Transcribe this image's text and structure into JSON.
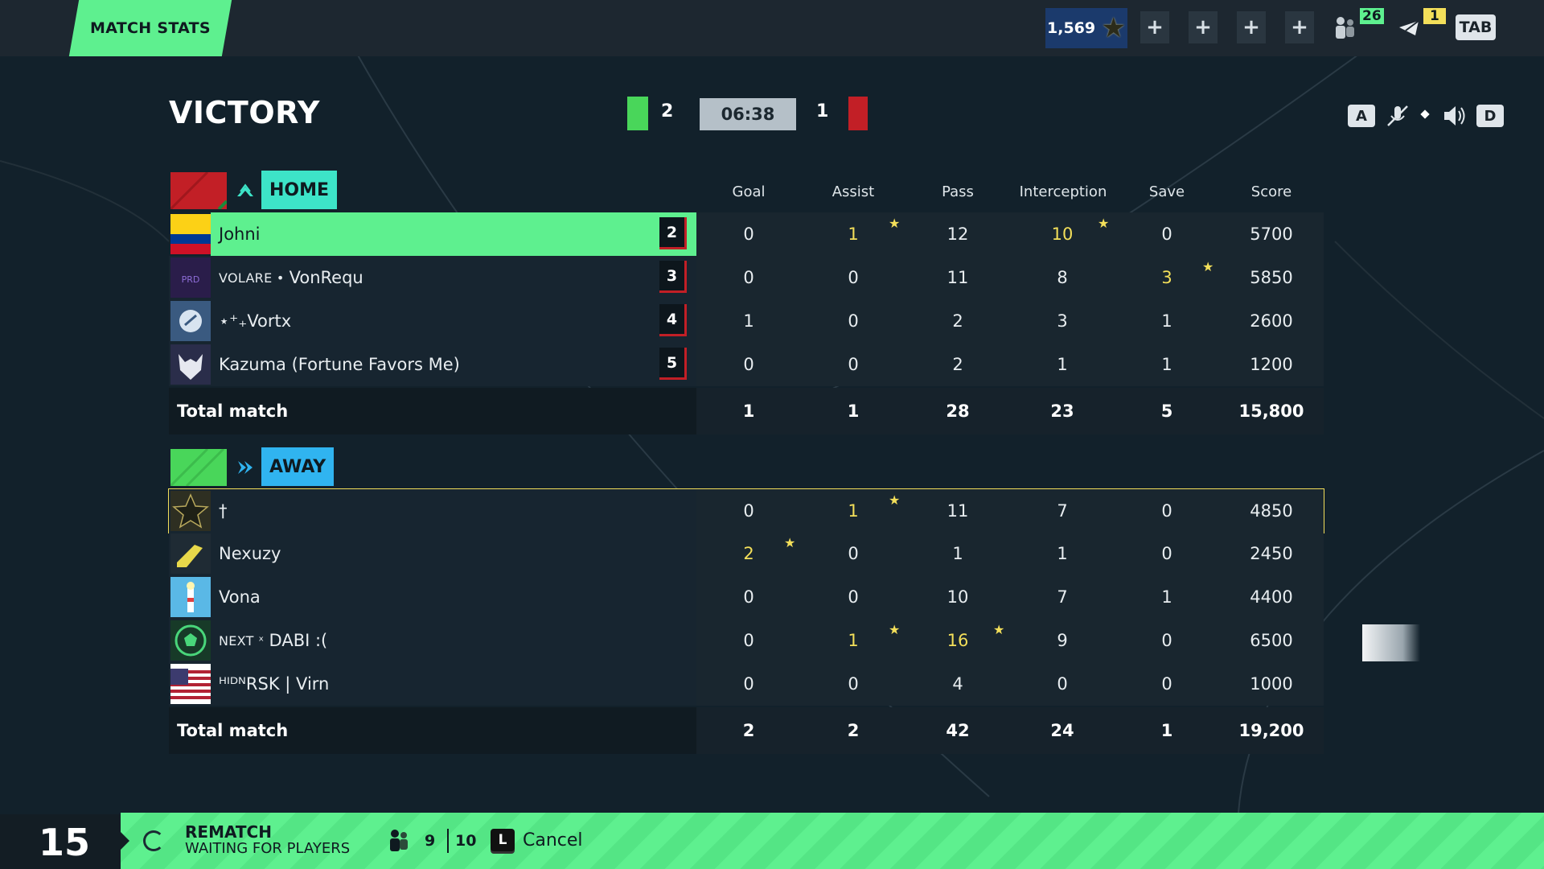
{
  "topbar": {
    "tab_label": "MATCH STATS",
    "currency": "1,569",
    "friends_count": "26",
    "mail_count": "1",
    "tab_key": "TAB",
    "accent": "#5ef08f"
  },
  "header": {
    "result": "VICTORY",
    "home_score": "2",
    "timer": "06:38",
    "away_score": "1",
    "voice_left_key": "A",
    "voice_right_key": "D"
  },
  "columns": [
    "Goal",
    "Assist",
    "Pass",
    "Interception",
    "Save",
    "Score"
  ],
  "home": {
    "name": "HOME",
    "color": "#3de4c8",
    "players": [
      {
        "name": "Johni",
        "tag": "",
        "rank": "2",
        "stats": [
          "0",
          "1",
          "12",
          "10",
          "0",
          "5700"
        ],
        "gold": [
          1,
          3
        ]
      },
      {
        "name": "VonRequ",
        "tag": "VOLARE •",
        "rank": "3",
        "stats": [
          "0",
          "0",
          "11",
          "8",
          "3",
          "5850"
        ],
        "gold": [
          4
        ]
      },
      {
        "name": "⋆⁺₊Vortx",
        "tag": "",
        "rank": "4",
        "stats": [
          "1",
          "0",
          "2",
          "3",
          "1",
          "2600"
        ],
        "gold": []
      },
      {
        "name": "Kazuma (Fortune Favors Me)",
        "tag": "",
        "rank": "5",
        "stats": [
          "0",
          "0",
          "2",
          "1",
          "1",
          "1200"
        ],
        "gold": []
      }
    ],
    "total_label": "Total match",
    "totals": [
      "1",
      "1",
      "28",
      "23",
      "5",
      "15,800"
    ]
  },
  "away": {
    "name": "AWAY",
    "color": "#30b4f0",
    "players": [
      {
        "name": "†",
        "tag": "",
        "stats": [
          "0",
          "1",
          "11",
          "7",
          "0",
          "4850"
        ],
        "gold": [
          1
        ]
      },
      {
        "name": "Nexuzy",
        "tag": "",
        "stats": [
          "2",
          "0",
          "1",
          "1",
          "0",
          "2450"
        ],
        "gold": [
          0
        ]
      },
      {
        "name": "Vona",
        "tag": "",
        "stats": [
          "0",
          "0",
          "10",
          "7",
          "1",
          "4400"
        ],
        "gold": []
      },
      {
        "name": "DABI :(",
        "tag": "NEXT ˣ",
        "stats": [
          "0",
          "1",
          "16",
          "9",
          "0",
          "6500"
        ],
        "gold": [
          1,
          2
        ]
      },
      {
        "name": "RSK | Virn",
        "tag": "ᴴᴵᴰᴺ",
        "stats": [
          "0",
          "0",
          "4",
          "0",
          "0",
          "1000"
        ],
        "gold": []
      }
    ],
    "total_label": "Total match",
    "totals": [
      "2",
      "2",
      "42",
      "24",
      "1",
      "19,200"
    ]
  },
  "bottom": {
    "countdown": "15",
    "rematch_title": "REMATCH",
    "rematch_status": "WAITING FOR PLAYERS",
    "players_ready": "9",
    "players_total": "10",
    "cancel_key": "L",
    "cancel_label": "Cancel"
  }
}
